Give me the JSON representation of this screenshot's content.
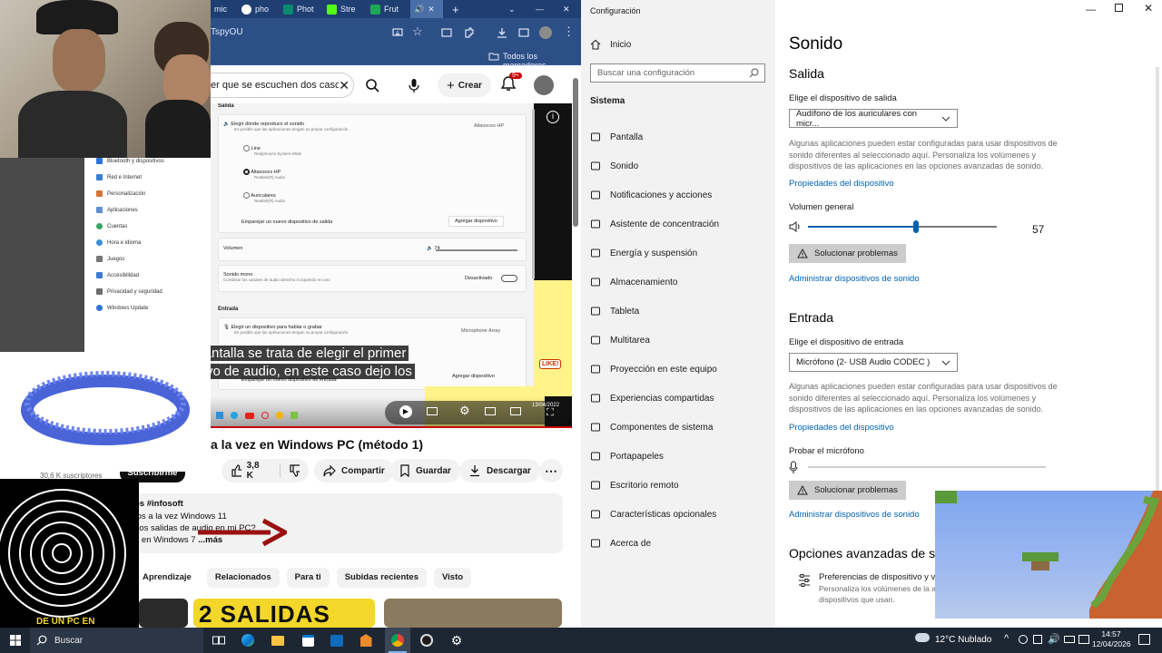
{
  "browser": {
    "tabs": [
      {
        "label": "mic",
        "color": "#d93025"
      },
      {
        "label": "pho",
        "color": "#ffffff"
      },
      {
        "label": "Phot",
        "color": "#0b8a6e"
      },
      {
        "label": "Stre",
        "color": "#53fc18"
      },
      {
        "label": "Frut",
        "color": "#1da954"
      }
    ],
    "url_fragment": "TspyOU",
    "bookmarks_label": "Todos los marcadores"
  },
  "youtube": {
    "search_text": "er que se escuchen dos casc",
    "create_label": "Crear",
    "notif_count": "9+",
    "video_title": "a la vez en Windows PC (método 1)",
    "subscribers": "30,6 K suscriptores",
    "subscribe_label": "Suscribirme",
    "likes": "3,8 K",
    "share_label": "Compartir",
    "save_label": "Guardar",
    "download_label": "Descargar",
    "channel_tag": "os  #infosoft",
    "desc_line1": "tos a la vez Windows 11",
    "desc_line2": "dos salidas de audio en mi PC?",
    "desc_line3": "o en Windows 7",
    "more_label": "...más",
    "chips": [
      "Aprendizaje",
      "Relacionados",
      "Para ti",
      "Subidas recientes",
      "Visto"
    ],
    "thumb1_text": "DE UN PC EN",
    "thumb2_text": "2 SALIDAS",
    "caption_line1": "en esta pantalla se trata de elegir el primer",
    "caption_line2": "vo de audio, en este caso dejo los",
    "video_date": "13/04/2022",
    "video_badge": "LIKE!"
  },
  "video_settings": {
    "section_output": "Salida",
    "choose_output": "Elegir dónde reproducir el sonido",
    "choose_output_sub": "Es posible que las aplicaciones tengan su propia configuración",
    "output_current": "Altavoces HP",
    "opt1": "Line",
    "opt1_sub": "Realphones System-Wide",
    "opt2": "Altavoces HP",
    "opt2_sub": "Realtek(R) Audio",
    "opt3": "Auriculares",
    "opt3_sub": "Realtek(R) Audio",
    "pair_output": "Emparejar un nuevo dispositivo de salida",
    "add_device": "Agregar dispositivo",
    "volume": "Volumen",
    "volume_value": "74",
    "mono": "Sonido mono",
    "mono_sub": "Combinar los canales de audio derecho e izquierdo en uno",
    "mono_state": "Desactivado",
    "section_input": "Entrada",
    "choose_input": "Elegir un dispositivo para hablar o grabar",
    "choose_input_sub": "Es posible que las aplicaciones tengan su propia configuración",
    "input_current": "Microphone Array",
    "pair_input": "Emparejar un nuevo dispositivo de entrada",
    "add_device2": "Agregar dispositivo"
  },
  "overlay_menu": [
    "Bluetooth y dispositivos",
    "Red e Internet",
    "Personalización",
    "Aplicaciones",
    "Cuentas",
    "Hora e idioma",
    "Juegos",
    "Accesibilidad",
    "Privacidad y seguridad",
    "Windows Update"
  ],
  "settings": {
    "window_title": "Configuración",
    "home": "Inicio",
    "search_placeholder": "Buscar una configuración",
    "group": "Sistema",
    "nav": [
      "Pantalla",
      "Sonido",
      "Notificaciones y acciones",
      "Asistente de concentración",
      "Energía y suspensión",
      "Almacenamiento",
      "Tableta",
      "Multitarea",
      "Proyección en este equipo",
      "Experiencias compartidas",
      "Componentes de sistema",
      "Portapapeles",
      "Escritorio remoto",
      "Características opcionales",
      "Acerca de"
    ],
    "page_title": "Sonido",
    "output_title": "Salida",
    "output_label": "Elige el dispositivo de salida",
    "output_device": "Audífono de los auriculares con micr...",
    "output_desc": "Algunas aplicaciones pueden estar configuradas para usar dispositivos de sonido diferentes al seleccionado aquí. Personaliza los volúmenes y dispositivos de las aplicaciones en las opciones avanzadas de sonido.",
    "device_props": "Propiedades del dispositivo",
    "master_volume": "Volumen general",
    "volume_value": "57",
    "volume_fraction": 0.57,
    "troubleshoot": "Solucionar problemas",
    "manage_devices": "Administrar dispositivos de sonido",
    "input_title": "Entrada",
    "input_label": "Elige el dispositivo de entrada",
    "input_device": "Micrófono (2- USB Audio CODEC )",
    "input_desc": "Algunas aplicaciones pueden estar configuradas para usar dispositivos de sonido diferentes al seleccionado aquí. Personaliza los volúmenes y dispositivos de las aplicaciones en las opciones avanzadas de sonido.",
    "device_props2": "Propiedades del dispositivo",
    "test_mic": "Probar el micrófono",
    "troubleshoot2": "Solucionar problemas",
    "manage_devices2": "Administrar dispositivos de sonido",
    "advanced_title": "Opciones avanzadas de sor",
    "app_prefs": "Preferencias de dispositivo y vo",
    "app_prefs_sub1": "Personaliza los volúmenes de la a",
    "app_prefs_sub2": "dispositivos que usan."
  },
  "taskbar": {
    "search_label": "Buscar",
    "weather": "12°C  Nublado",
    "time": "14:57",
    "date": "12/04/2026"
  }
}
